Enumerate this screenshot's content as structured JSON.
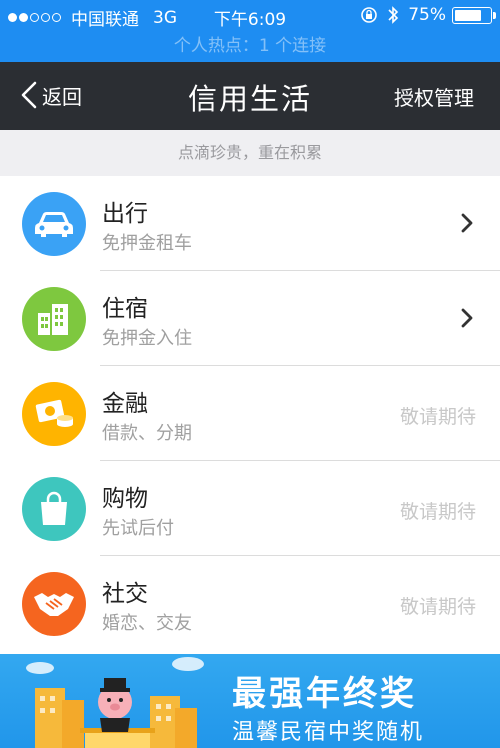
{
  "status_bar": {
    "carrier": "中国联通",
    "network": "3G",
    "time": "下午6:09",
    "battery": "75%",
    "battery_level": 0.75,
    "signal_bars": 2
  },
  "hotspot": {
    "text": "个人热点：1 个连接"
  },
  "nav": {
    "back_label": "返回",
    "title": "信用生活",
    "right_label": "授权管理"
  },
  "tagline": "点滴珍贵，重在积累",
  "list": [
    {
      "title": "出行",
      "subtitle": "免押金租车",
      "icon": "car-icon",
      "color": "#3aa2f5",
      "action": "chevron"
    },
    {
      "title": "住宿",
      "subtitle": "免押金入住",
      "icon": "building-icon",
      "color": "#7ec83f",
      "action": "chevron"
    },
    {
      "title": "金融",
      "subtitle": "借款、分期",
      "icon": "money-icon",
      "color": "#ffb400",
      "status": "敬请期待"
    },
    {
      "title": "购物",
      "subtitle": "先试后付",
      "icon": "shopping-bag-icon",
      "color": "#3ec6be",
      "status": "敬请期待"
    },
    {
      "title": "社交",
      "subtitle": "婚恋、交友",
      "icon": "handshake-icon",
      "color": "#f5651f",
      "status": "敬请期待"
    }
  ],
  "banner": {
    "headline": "最强年终奖",
    "subline": "温馨民宿中奖随机"
  },
  "colors": {
    "status_bar": "#1e8df2",
    "nav_bar": "#2b2e33",
    "tagline_bg": "#efeff2",
    "banner": "#2196ea"
  }
}
